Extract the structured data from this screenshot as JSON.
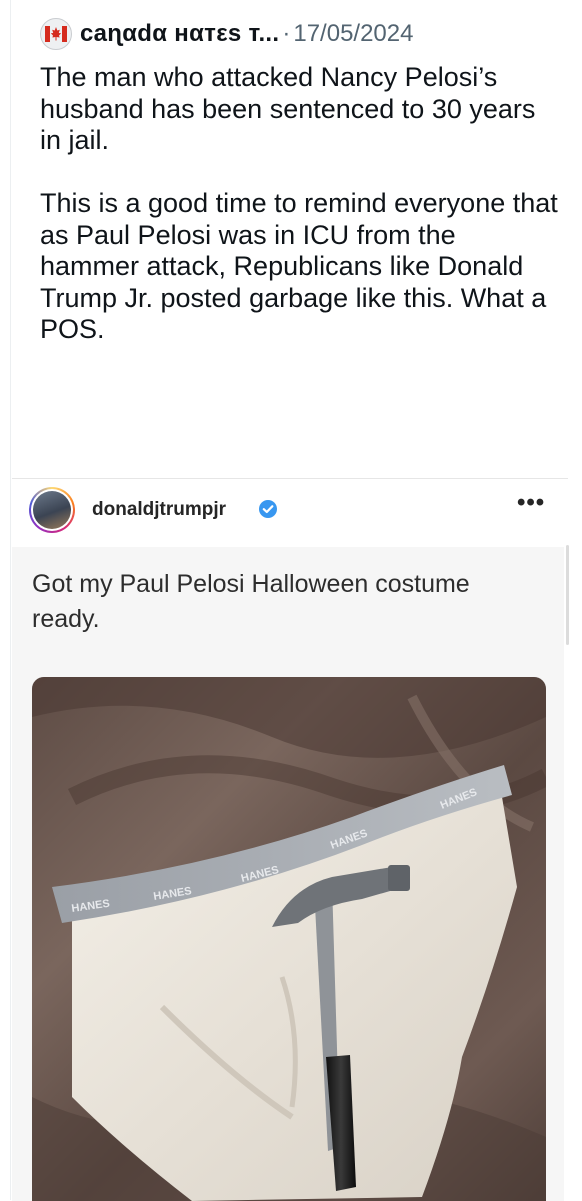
{
  "tweet": {
    "avatar_icon": "canada-flag-icon",
    "display_name": "caɳαdα нαтεѕ т...",
    "separator": "·",
    "date": "17/05/2024",
    "paragraph1": "The man who attacked Nancy Pelosi’s husband has been sentenced to 30 years in jail.",
    "paragraph2": "This is a good time to remind everyone that as Paul Pelosi was in ICU from the hammer attack, Republicans like Donald Trump Jr. posted garbage like this. What a POS."
  },
  "quoted_post": {
    "username": "donaldjtrumpjr",
    "verified_icon": "verified-badge-icon",
    "more_icon": "more-options-icon",
    "more_label": "•••",
    "caption": "Got my Paul Pelosi Halloween costume ready.",
    "photo": {
      "description_icon": "underwear-and-hammer-photo",
      "waistband_texts": [
        "HANES",
        "HANES",
        "HANES",
        "HANES",
        "HANES"
      ]
    }
  },
  "colors": {
    "text_primary": "#0f1419",
    "text_secondary": "#536471",
    "verified_blue": "#3897f0",
    "card_bg": "#f6f6f6",
    "sheet_brown": "#6b574f"
  }
}
